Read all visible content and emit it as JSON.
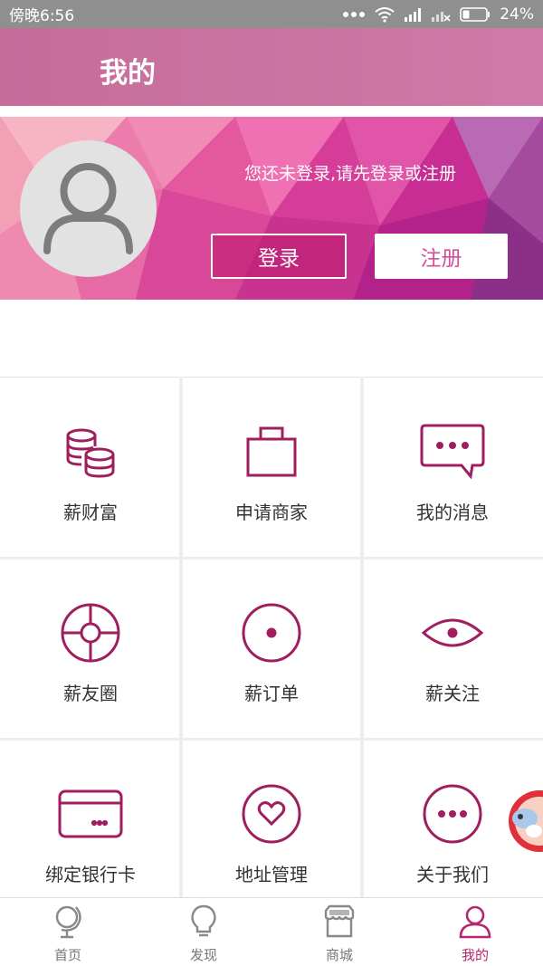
{
  "status_bar": {
    "time": "傍晚6:56",
    "battery": "24%"
  },
  "header": {
    "title": "我的"
  },
  "profile": {
    "prompt": "您还未登录,请先登录或注册",
    "login_label": "登录",
    "register_label": "注册"
  },
  "grid": {
    "items": [
      {
        "label": "薪财富",
        "icon": "coins-icon"
      },
      {
        "label": "申请商家",
        "icon": "bag-icon"
      },
      {
        "label": "我的消息",
        "icon": "message-icon"
      },
      {
        "label": "薪友圈",
        "icon": "circle-target-icon"
      },
      {
        "label": "薪订单",
        "icon": "dot-circle-icon"
      },
      {
        "label": "薪关注",
        "icon": "eye-icon"
      },
      {
        "label": "绑定银行卡",
        "icon": "bank-card-icon"
      },
      {
        "label": "地址管理",
        "icon": "heart-circle-icon"
      },
      {
        "label": "关于我们",
        "icon": "more-circle-icon"
      }
    ]
  },
  "tabbar": {
    "items": [
      {
        "label": "首页",
        "icon": "globe-icon"
      },
      {
        "label": "发现",
        "icon": "bulb-icon"
      },
      {
        "label": "商城",
        "icon": "store-icon"
      },
      {
        "label": "我的",
        "icon": "user-icon"
      }
    ],
    "active_index": 3
  },
  "colors": {
    "accent": "#b8246f",
    "header": "#cc76a6",
    "icon_stroke": "#a01e5f"
  }
}
